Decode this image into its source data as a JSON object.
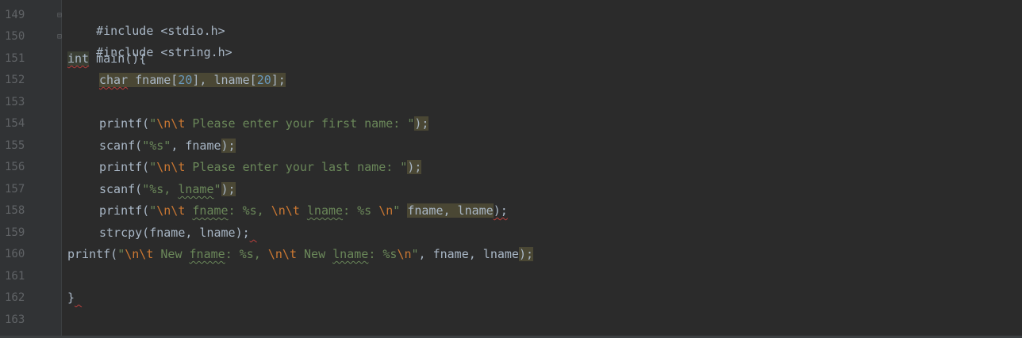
{
  "line_numbers": [
    "149",
    "150",
    "151",
    "152",
    "153",
    "154",
    "155",
    "156",
    "157",
    "158",
    "159",
    "160",
    "161",
    "162",
    "163"
  ],
  "code": {
    "l149": "#include <stdio.h>",
    "l150": "#include <string.h>",
    "l151_kw": "int",
    "l151_rest": " main(){",
    "l152_kw": "char",
    "l152_a": " fname[",
    "l152_n1": "20",
    "l152_b": "], lname[",
    "l152_n2": "20",
    "l152_c": "];",
    "l154_fn": "printf(",
    "l154_str1": "\"",
    "l154_esc": "\\n\\t",
    "l154_str2": " Please enter your first name: \"",
    "l154_end": ");",
    "l155_fn": "scanf(",
    "l155_str": "\"%s\"",
    "l155_rest": ", fname",
    "l155_end": ");",
    "l156_fn": "printf(",
    "l156_str1": "\"",
    "l156_esc": "\\n\\t",
    "l156_str2": " Please enter your last name: \"",
    "l156_end": ");",
    "l157_fn": "scanf(",
    "l157_str1": "\"%s, ",
    "l157_word": "lname",
    "l157_str2": "\"",
    "l157_end": ");",
    "l158_fn": "printf(",
    "l158_q": "\"",
    "l158_esc1": "\\n\\t",
    "l158_sp1": " ",
    "l158_w1": "fname",
    "l158_s2": ": %s, ",
    "l158_esc2": "\\n\\t",
    "l158_sp2": " ",
    "l158_w2": "lname",
    "l158_s3": ": %s ",
    "l158_esc3": "\\n",
    "l158_q2": "\"",
    "l158_sp3": " ",
    "l158_args": "fname, lname",
    "l158_end": ");",
    "l159_fn": "strcpy(fname, lname);",
    "l160_fn": "printf(",
    "l160_q": "\"",
    "l160_esc1": "\\n\\t",
    "l160_s1": " New ",
    "l160_w1": "fname",
    "l160_s2": ": %s, ",
    "l160_esc2": "\\n\\t",
    "l160_s3": " New ",
    "l160_w2": "lname",
    "l160_s4": ": %s",
    "l160_esc3": "\\n",
    "l160_q2": "\"",
    "l160_args": ", fname, lname",
    "l160_end": ");",
    "l162": "}"
  },
  "colors": {
    "background": "#2b2b2b",
    "keyword": "#cc7832",
    "string": "#6a8759",
    "number": "#6897bb",
    "text": "#a9b7c6"
  }
}
